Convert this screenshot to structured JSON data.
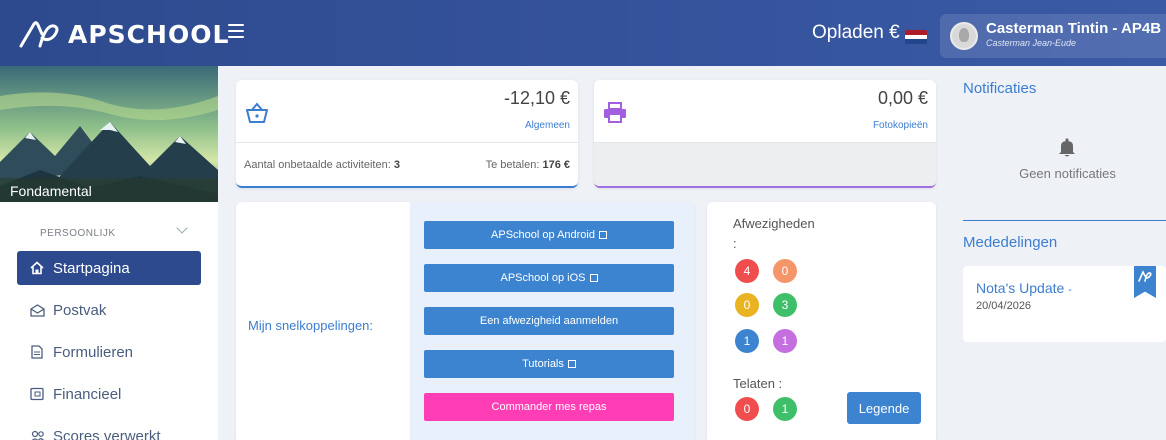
{
  "header": {
    "brand": "APSCHOOL",
    "topup_label": "Opladen €",
    "user_name": "Casterman Tintin - AP4B",
    "user_sub": "Casterman Jean-Eude",
    "flag_colors": [
      "#ae1c28",
      "#ffffff",
      "#21468b"
    ]
  },
  "sidebar": {
    "banner_label": "Fondamental",
    "section_title": "PERSOONLIJK",
    "items": [
      {
        "label": "Startpagina",
        "icon": "home-icon",
        "active": true
      },
      {
        "label": "Postvak",
        "icon": "envelope-icon"
      },
      {
        "label": "Formulieren",
        "icon": "document-icon"
      },
      {
        "label": "Financieel",
        "icon": "wallet-icon"
      },
      {
        "label": "Scores verwerkt",
        "icon": "users-icon"
      }
    ]
  },
  "balance_general": {
    "amount": "-12,10 €",
    "label": "Algemeen",
    "unpaid_label": "Aantal onbetaalde activiteiten:",
    "unpaid_count": "3",
    "to_pay_label": "Te betalen:",
    "to_pay_value": "176 €"
  },
  "balance_copies": {
    "amount": "0,00 €",
    "label": "Fotokopieën"
  },
  "shortcuts": {
    "label": "Mijn snelkoppelingen:",
    "buttons": [
      {
        "label": "APSchool op Android",
        "external": true
      },
      {
        "label": "APSchool op iOS",
        "external": true
      },
      {
        "label": "Een afwezigheid aanmelden",
        "external": false
      },
      {
        "label": "Tutorials",
        "external": true
      },
      {
        "label": "Commander mes repas",
        "external": false
      }
    ]
  },
  "absences": {
    "title": "Afwezigheden",
    "colon": ":",
    "counts": [
      {
        "value": "4",
        "color": "#f04e4e"
      },
      {
        "value": "0",
        "color": "#f5956a"
      },
      {
        "value": "0",
        "color": "#e9b324"
      },
      {
        "value": "3",
        "color": "#3fbf6a"
      },
      {
        "value": "1",
        "color": "#3c84cf"
      },
      {
        "value": "1",
        "color": "#c46ee0"
      }
    ],
    "late_title": "Telaten :",
    "late_counts": [
      {
        "value": "0",
        "color": "#f04e4e"
      },
      {
        "value": "1",
        "color": "#3fbf6a"
      }
    ],
    "legend_label": "Legende"
  },
  "notifications": {
    "title": "Notificaties",
    "empty_text": "Geen notificaties"
  },
  "announcements": {
    "title": "Mededelingen",
    "items": [
      {
        "title": "Nota's Update",
        "separator": "-",
        "date": "20/04/2026"
      }
    ]
  }
}
